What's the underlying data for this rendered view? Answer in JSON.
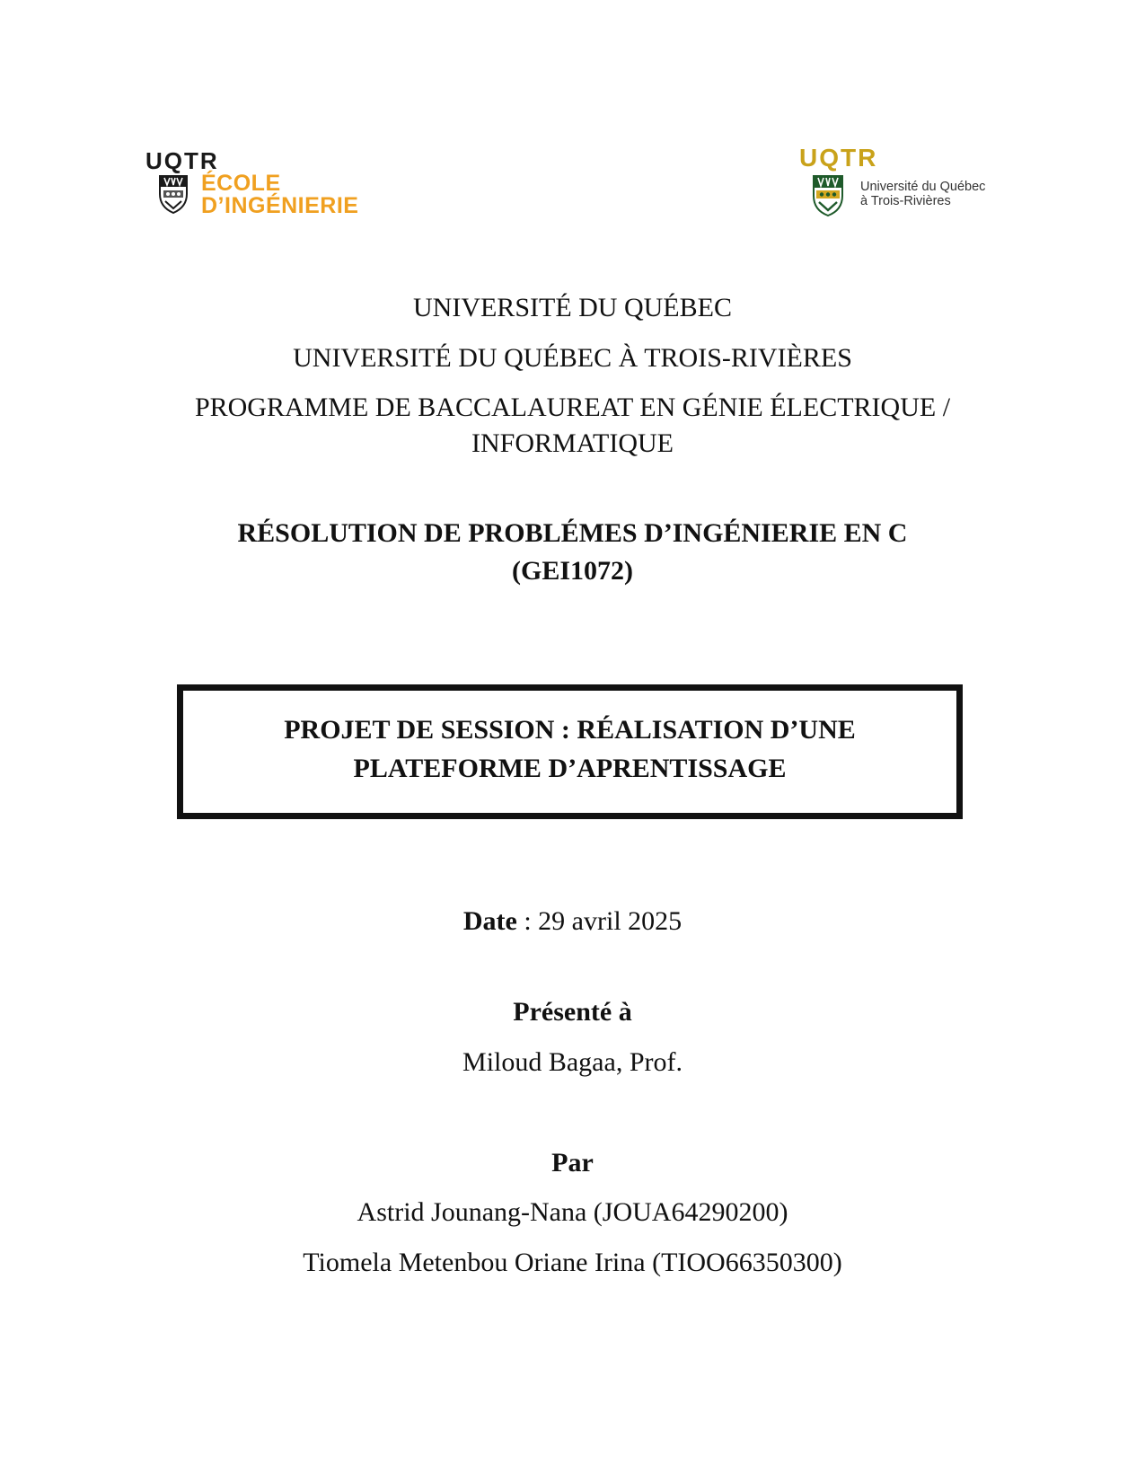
{
  "logos": {
    "left": {
      "brand": "UQTR",
      "line1": "ÉCOLE",
      "line2": "D’INGÉNIERIE",
      "icon": "shield-icon",
      "brand_color": "#1a1a1a",
      "text_color": "#f0a020"
    },
    "right": {
      "brand": "UQTR",
      "line1": "Université du Québec",
      "line2": "à Trois-Rivières",
      "icon": "shield-icon",
      "brand_color": "#c9a21a"
    }
  },
  "header": {
    "university": "UNIVERSITÉ DU QUÉBEC",
    "campus": "UNIVERSITÉ DU QUÉBEC À TROIS-RIVIÈRES",
    "program_line1": "PROGRAMME DE BACCALAUREAT EN GÉNIE ÉLECTRIQUE /",
    "program_line2": "INFORMATIQUE"
  },
  "course": {
    "title_line1": "RÉSOLUTION DE PROBLÉMES D’INGÉNIERIE EN C",
    "title_line2": "(GEI1072)"
  },
  "project": {
    "line1": "PROJET DE SESSION : RÉALISATION D’UNE",
    "line2": "PLATEFORME D’APRENTISSAGE"
  },
  "date": {
    "label": "Date",
    "separator": " : ",
    "value": "29 avril 2025"
  },
  "presented_to": {
    "label": "Présenté à",
    "name": "Miloud Bagaa, Prof."
  },
  "authors": {
    "label": "Par",
    "list": [
      "Astrid Jounang-Nana (JOUA64290200)",
      "Tiomela Metenbou Oriane Irina (TIOO66350300)"
    ]
  }
}
